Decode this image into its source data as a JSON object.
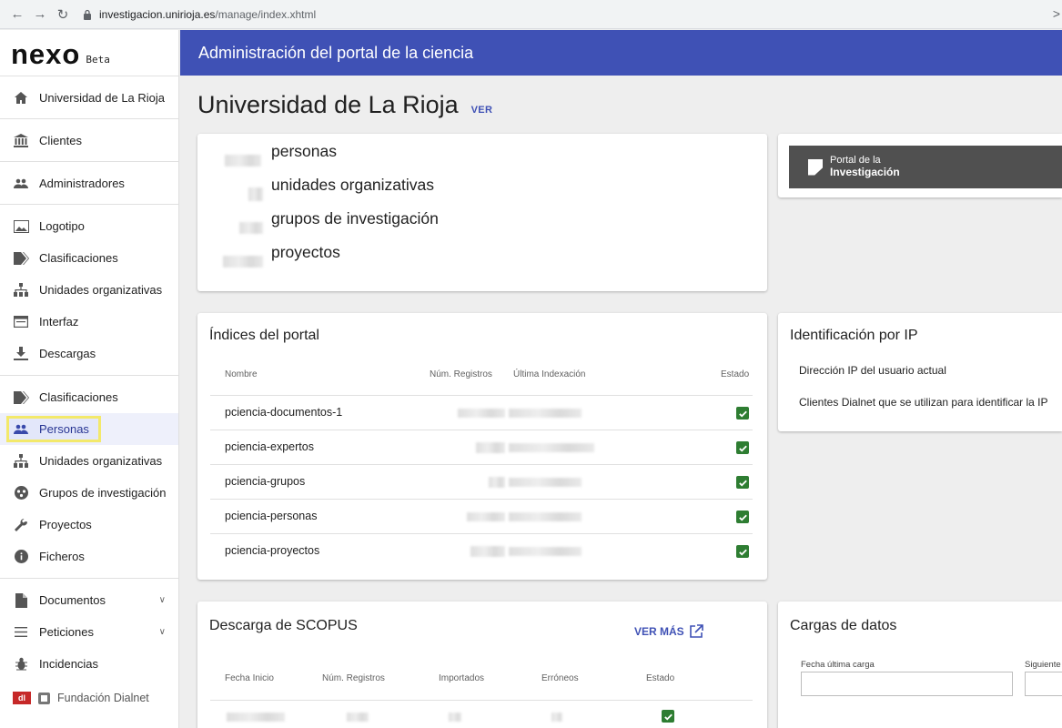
{
  "browser": {
    "url_host": "investigacion.unirioja.es",
    "url_path": "/manage/index.xhtml"
  },
  "logo": {
    "name": "nexo",
    "badge": "Beta"
  },
  "sidebar": {
    "items": [
      {
        "label": "Universidad de La Rioja",
        "icon": "home-icon"
      },
      {
        "label": "Clientes",
        "icon": "bank-icon"
      },
      {
        "label": "Administradores",
        "icon": "people-icon"
      },
      {
        "label": "Logotipo",
        "icon": "image-icon"
      },
      {
        "label": "Clasificaciones",
        "icon": "tag-icon"
      },
      {
        "label": "Unidades organizativas",
        "icon": "org-chart-icon"
      },
      {
        "label": "Interfaz",
        "icon": "window-icon"
      },
      {
        "label": "Descargas",
        "icon": "download-icon"
      },
      {
        "label": "Clasificaciones",
        "icon": "tag-icon"
      },
      {
        "label": "Personas",
        "icon": "people-icon"
      },
      {
        "label": "Unidades organizativas",
        "icon": "org-chart-icon"
      },
      {
        "label": "Grupos de investigación",
        "icon": "group-icon"
      },
      {
        "label": "Proyectos",
        "icon": "wrench-icon"
      },
      {
        "label": "Ficheros",
        "icon": "info-icon"
      },
      {
        "label": "Documentos",
        "icon": "document-icon"
      },
      {
        "label": "Peticiones",
        "icon": "list-icon"
      },
      {
        "label": "Incidencias",
        "icon": "bug-icon"
      }
    ],
    "footer": "Fundación Dialnet"
  },
  "header": {
    "title": "Administración del portal de la ciencia"
  },
  "page": {
    "title": "Universidad de La Rioja",
    "ver_link": "VER"
  },
  "stats": [
    {
      "label": "personas"
    },
    {
      "label": "unidades organizativas"
    },
    {
      "label": "grupos de investigación"
    },
    {
      "label": "proyectos"
    }
  ],
  "portal_logo": {
    "line1": "Portal de la",
    "line2": "Investigación"
  },
  "indices": {
    "title": "Índices del portal",
    "headers": {
      "nombre": "Nombre",
      "registros": "Núm. Registros",
      "indexacion": "Última Indexación",
      "estado": "Estado"
    },
    "rows": [
      {
        "name": "pciencia-documentos-1",
        "estado": "ok"
      },
      {
        "name": "pciencia-expertos",
        "estado": "ok"
      },
      {
        "name": "pciencia-grupos",
        "estado": "ok"
      },
      {
        "name": "pciencia-personas",
        "estado": "ok"
      },
      {
        "name": "pciencia-proyectos",
        "estado": "ok"
      }
    ]
  },
  "ip": {
    "title": "Identificación por IP",
    "line1": "Dirección IP del usuario actual",
    "line2": "Clientes Dialnet que se utilizan para identificar la IP"
  },
  "scopus": {
    "title": "Descarga de SCOPUS",
    "ver_mas": "VER MÁS",
    "headers": {
      "fecha": "Fecha Inicio",
      "registros": "Núm. Registros",
      "importados": "Importados",
      "erroneos": "Erróneos",
      "estado": "Estado"
    }
  },
  "cargas": {
    "title": "Cargas de datos",
    "field1": "Fecha última carga",
    "field2": "Siguiente"
  }
}
